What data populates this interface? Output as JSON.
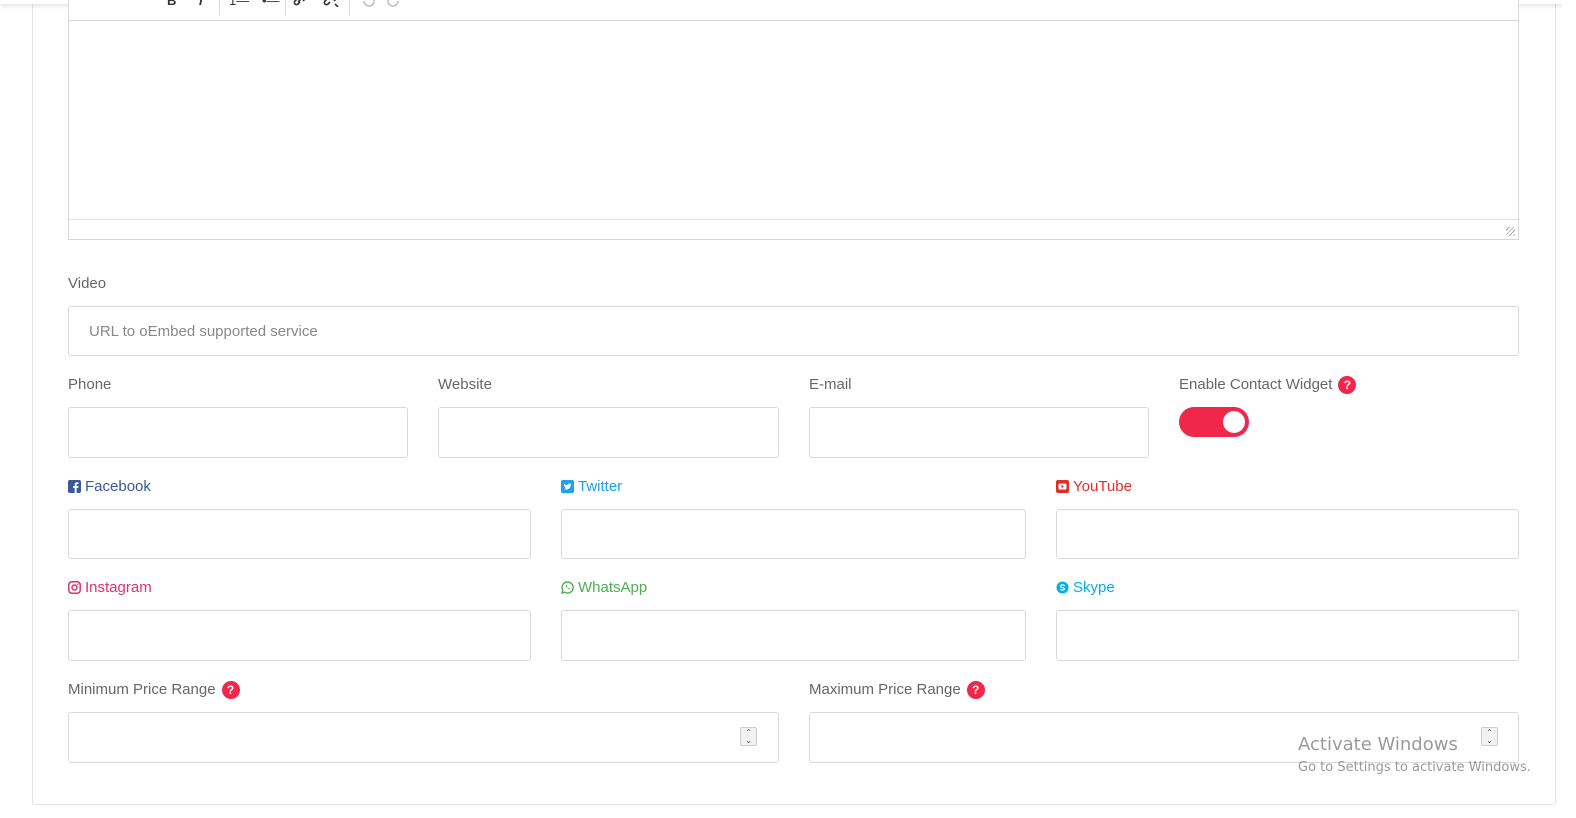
{
  "editor": {
    "toolbar": {
      "bold_label": "B",
      "italic_label": "I",
      "ol_label": "1—",
      "ul_label": "•—",
      "link_icon": "link-icon",
      "unlink_icon": "unlink-icon",
      "undo_icon": "undo-icon",
      "redo_icon": "redo-icon"
    }
  },
  "video": {
    "label": "Video",
    "placeholder": "URL to oEmbed supported service",
    "value": ""
  },
  "phone": {
    "label": "Phone",
    "value": ""
  },
  "website": {
    "label": "Website",
    "value": ""
  },
  "email": {
    "label": "E-mail",
    "value": ""
  },
  "contact_widget": {
    "label": "Enable Contact Widget",
    "help": "?",
    "enabled": true
  },
  "social": {
    "facebook": {
      "label": "Facebook",
      "color": "#3b5998",
      "icon": "facebook-icon",
      "value": ""
    },
    "twitter": {
      "label": "Twitter",
      "color": "#1da1f2",
      "icon": "twitter-icon",
      "value": ""
    },
    "youtube": {
      "label": "YouTube",
      "color": "#e52d27",
      "icon": "youtube-icon",
      "value": ""
    },
    "instagram": {
      "label": "Instagram",
      "color": "#e1306c",
      "icon": "instagram-icon",
      "value": ""
    },
    "whatsapp": {
      "label": "WhatsApp",
      "color": "#4caf50",
      "icon": "whatsapp-icon",
      "value": ""
    },
    "skype": {
      "label": "Skype",
      "color": "#00aff0",
      "icon": "skype-icon",
      "value": ""
    }
  },
  "price": {
    "min_label": "Minimum Price Range",
    "max_label": "Maximum Price Range",
    "help": "?",
    "min_value": "",
    "max_value": ""
  },
  "watermark": {
    "title": "Activate Windows",
    "subtitle": "Go to Settings to activate Windows."
  },
  "colors": {
    "accent": "#f0264b"
  }
}
